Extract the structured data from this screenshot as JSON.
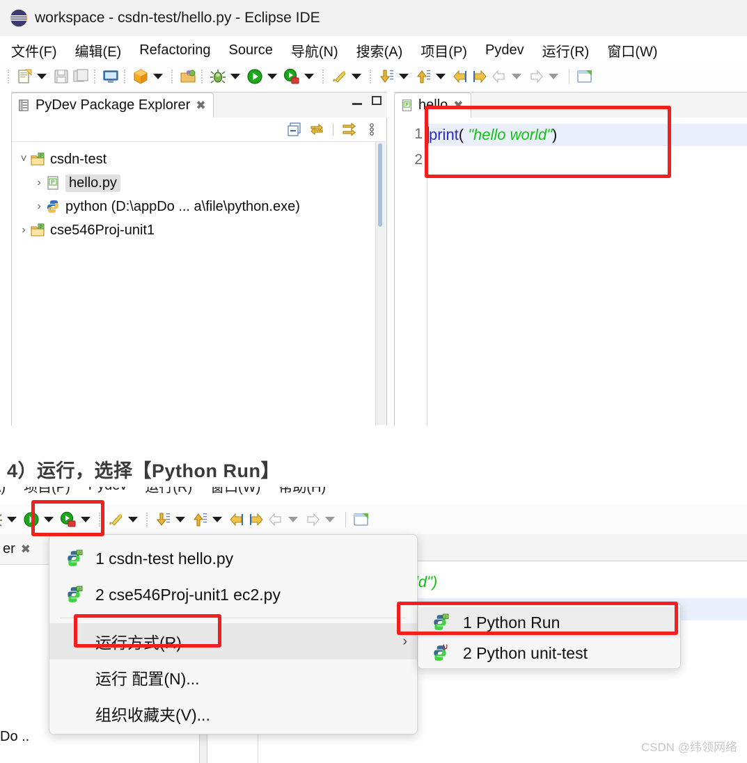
{
  "window": {
    "title": "workspace - csdn-test/hello.py - Eclipse IDE",
    "logo_icon": "eclipse-logo-icon"
  },
  "menubar": {
    "items": [
      {
        "label": "文件(F)",
        "mnemonic": "F"
      },
      {
        "label": "编辑(E)",
        "mnemonic": "E"
      },
      {
        "label": "Refactoring",
        "mnemonic": "t"
      },
      {
        "label": "Source",
        "mnemonic": "S"
      },
      {
        "label": "导航(N)",
        "mnemonic": "N"
      },
      {
        "label": "搜索(A)",
        "mnemonic": "A"
      },
      {
        "label": "项目(P)",
        "mnemonic": "P"
      },
      {
        "label": "Pydev",
        "mnemonic": "y"
      },
      {
        "label": "运行(R)",
        "mnemonic": "R"
      },
      {
        "label": "窗口(W)",
        "mnemonic": "W"
      },
      {
        "label": "帮助(H)",
        "mnemonic": "H"
      }
    ]
  },
  "toolbar": {
    "icons": [
      "new-file-icon",
      "save-icon",
      "save-all-icon",
      "console-icon",
      "export-package-icon",
      "open-perspective-icon",
      "debug-icon",
      "run-icon",
      "coverage-icon",
      "pydev-package-icon",
      "next-annotation-icon",
      "previous-annotation-icon",
      "back-history-icon",
      "forward-history-icon",
      "previous-edit-icon",
      "next-edit-icon",
      "new-editor-icon"
    ]
  },
  "package_explorer": {
    "tab_label": "PyDev Package Explorer",
    "close_icon": "close-icon",
    "view_icon": "pydev-package-explorer-icon",
    "minimize_icon": "minimize-icon",
    "maximize_icon": "maximize-icon",
    "toolbar_icons": [
      "collapse-all-icon",
      "link-with-editor-icon",
      "focus-on-active-task-icon",
      "view-menu-icon"
    ],
    "tree": [
      {
        "label": "csdn-test",
        "icon": "python-project-icon",
        "expander": "chevron-down-icon",
        "depth": 0,
        "selected": false
      },
      {
        "label": "hello.py",
        "icon": "python-file-icon",
        "expander": "chevron-right-icon",
        "depth": 1,
        "selected": true
      },
      {
        "label": "python  (D:\\appDo ... a\\file\\python.exe)",
        "icon": "python-interpreter-icon",
        "expander": "chevron-right-icon",
        "depth": 1,
        "selected": false
      },
      {
        "label": "cse546Proj-unit1",
        "icon": "python-project-icon",
        "expander": "chevron-right-icon",
        "depth": 0,
        "selected": false
      }
    ]
  },
  "editor": {
    "tab_label": "hello",
    "tab_icon": "python-file-icon",
    "close_icon": "close-icon",
    "line_numbers": [
      "1",
      "2"
    ],
    "code": {
      "func": "print",
      "paren_open": "(",
      "string": "\"hello world\"",
      "paren_close": ")"
    },
    "colors": {
      "keyword": "#2a2ad0",
      "string": "#14c214",
      "line_highlight": "#e9f0fb"
    }
  },
  "annotation": {
    "box_color": "#f21f1f",
    "heading": "4）运行，选择【Python Run】"
  },
  "run_dropdown": {
    "items": [
      {
        "label": "1 csdn-test hello.py",
        "icon": "python-run-icon",
        "has_icon": true,
        "hover": false,
        "submenu": false
      },
      {
        "label": "2 cse546Proj-unit1 ec2.py",
        "icon": "python-run-icon",
        "has_icon": true,
        "hover": false,
        "submenu": false
      },
      {
        "separator": true
      },
      {
        "label": "运行方式(R)",
        "icon": "",
        "has_icon": false,
        "hover": true,
        "submenu": true,
        "submenu_arrow": "›"
      },
      {
        "label": "运行 配置(N)...",
        "icon": "",
        "has_icon": false,
        "hover": false,
        "submenu": false
      },
      {
        "label": "组织收藏夹(V)...",
        "icon": "",
        "has_icon": false,
        "hover": false,
        "submenu": false
      }
    ]
  },
  "run_submenu": {
    "items": [
      {
        "label": "1 Python Run",
        "icon": "python-run-icon",
        "hover": true
      },
      {
        "label": "2 Python unit-test",
        "icon": "python-unittest-icon",
        "hover": false
      }
    ]
  },
  "background": {
    "explorer_tab_fragment": "er",
    "path_fragment": "Do ..",
    "code_fragment": "ld\")"
  },
  "watermark": "CSDN @纬领网络"
}
